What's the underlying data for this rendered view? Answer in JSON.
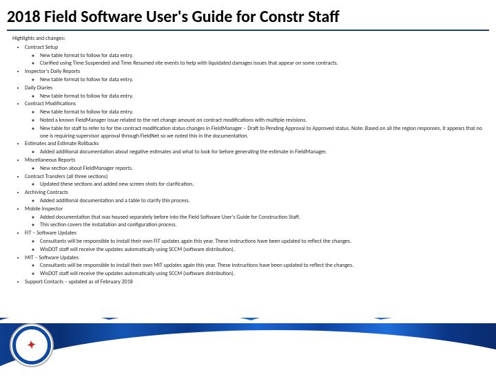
{
  "title": "2018 Field Software User's Guide for Constr Staff",
  "heading": "Highlights and changes:",
  "items": [
    {
      "label": "Contract Setup",
      "sub": [
        "New table format to follow for data entry.",
        "Clarified using Time Suspended and Time Resumed site events to help with liquidated damages issues that appear on some contracts."
      ]
    },
    {
      "label": "Inspector's Daily Reports",
      "sub": [
        "New table format to follow for data entry."
      ]
    },
    {
      "label": "Daily Diaries",
      "sub": [
        "New table format to follow for data entry."
      ]
    },
    {
      "label": "Contract Modifications",
      "sub": [
        "New table format to follow for data entry.",
        "Noted a known FieldManager issue related to the net change amount on contract modifications with multiple revisions.",
        "New table for staff to refer to for the contract modification status changes in FieldManager – Draft to Pending Approval to Approved status. Note: Based on all the region responses, it appears that no one is requiring supervisor approval through FieldNet so we noted this in the documentation."
      ]
    },
    {
      "label": "Estimates and Estimate Rollbacks",
      "sub": [
        "Added additional documentation about negative estimates and what to look for before generating the estimate in FieldManager."
      ]
    },
    {
      "label": "Miscellaneous Reports",
      "sub": [
        "New section about FieldManager reports."
      ]
    },
    {
      "label": "Contract Transfers (all three sections)",
      "sub": [
        "Updated these sections and added new screen shots for clarification."
      ]
    },
    {
      "label": "Archiving Contracts",
      "sub": [
        "Added additional documentation and a table to clarify this process."
      ]
    },
    {
      "label": "Mobile Inspector",
      "sub": [
        "Added documentation that was housed separately before into the Field Software User's Guide for Construction Staff.",
        "This section covers the installation and configuration process."
      ]
    },
    {
      "label": "FIT – Software Updates",
      "sub": [
        "Consultants will be responsible to install their own FIT updates again this year. These instructions have been updated to reflect the changes.",
        "WisDOT staff will receive the updates automatically using SCCM (software distribution)."
      ]
    },
    {
      "label": "MIT – Software Updates",
      "sub": [
        "Consultants will be responsible to install their own MIT updates again this year. These instructions have been updated to reflect the changes.",
        "WisDOT staff will receive the updates automatically using SCCM (software distribution)."
      ]
    },
    {
      "label": "Support Contacts – updated as of February 2018",
      "sub": []
    }
  ]
}
